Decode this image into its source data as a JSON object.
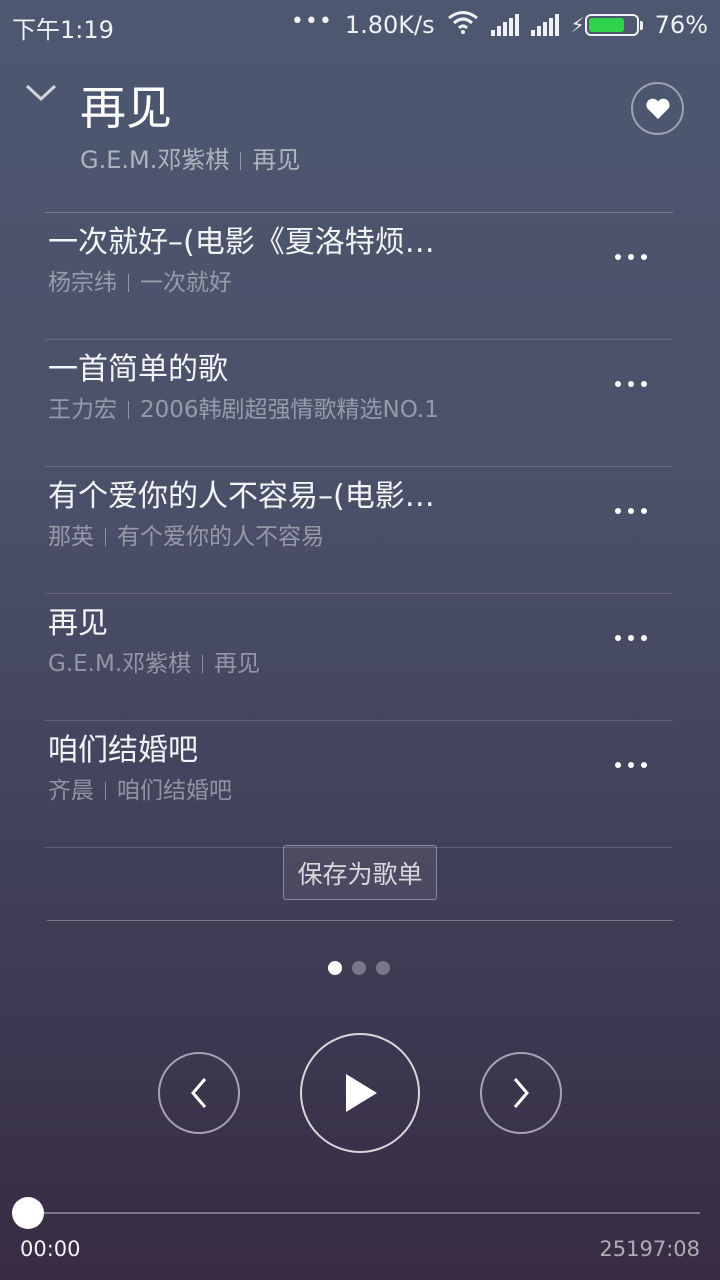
{
  "status_bar": {
    "time": "下午1:19",
    "network_speed": "1.80K/s",
    "battery": "76%",
    "battery_level": 0.76,
    "icons": [
      "more-dots-icon",
      "wifi-icon",
      "signal-icon",
      "signal-icon",
      "charging-icon",
      "battery-icon"
    ]
  },
  "header": {
    "title": "再见",
    "artist": "G.E.M.邓紫棋",
    "album": "再见",
    "collapse_icon": "chevron-down-icon",
    "favorite_icon": "heart-icon"
  },
  "playlist": [
    {
      "title": "一次就好–(电影《夏洛特烦…",
      "artist": "杨宗纬",
      "album": "一次就好"
    },
    {
      "title": "一首简单的歌",
      "artist": "王力宏",
      "album": "2006韩剧超强情歌精选NO.1"
    },
    {
      "title": "有个爱你的人不容易–(电影…",
      "artist": "那英",
      "album": "有个爱你的人不容易"
    },
    {
      "title": "再见",
      "artist": "G.E.M.邓紫棋",
      "album": "再见"
    },
    {
      "title": "咱们结婚吧",
      "artist": "齐晨",
      "album": "咱们结婚吧"
    }
  ],
  "actions": {
    "save_playlist": "保存为歌单"
  },
  "pager": {
    "pages": 3,
    "current": 1
  },
  "player": {
    "elapsed": "00:00",
    "total": "25197:08",
    "progress": 0,
    "controls": [
      "previous-icon",
      "play-icon",
      "next-icon"
    ]
  },
  "colors": {
    "battery_fill": "#2fd24a",
    "background_top": "#4d5870",
    "background_bottom": "#372c43"
  }
}
